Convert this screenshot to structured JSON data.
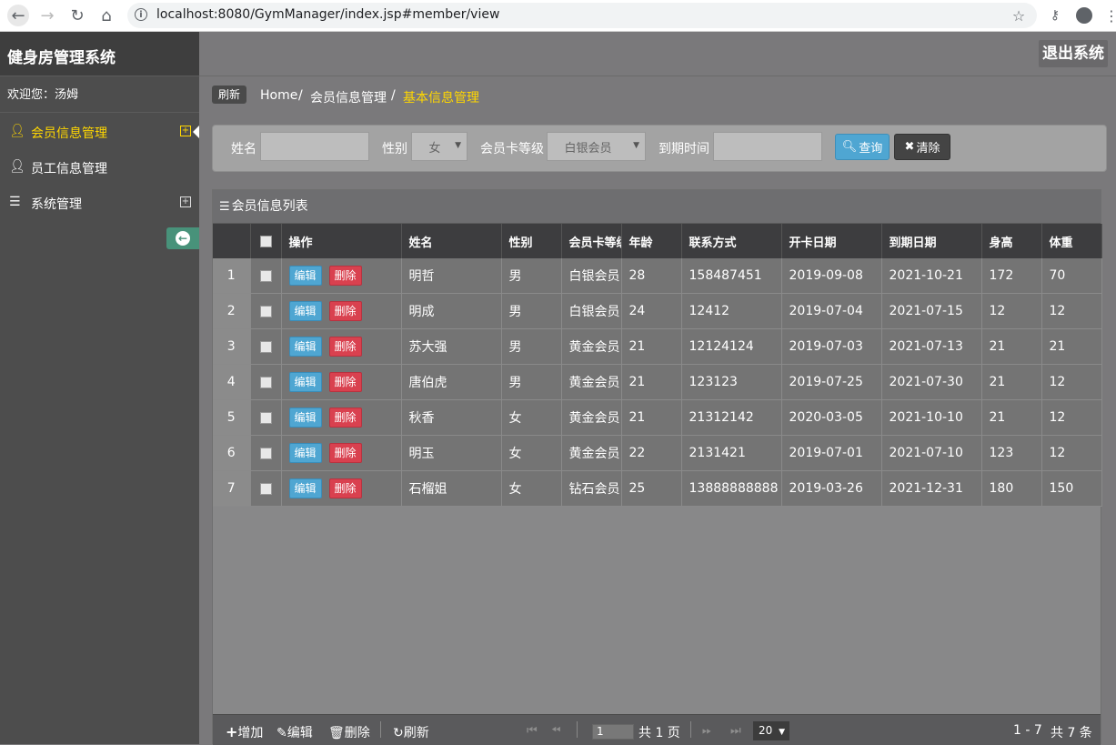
{
  "browser": {
    "url": "localhost:8080/GymManager/index.jsp#member/view"
  },
  "app": {
    "title": "健身房管理系统",
    "welcome": "欢迎您：汤姆",
    "logout": "退出系统"
  },
  "sidebar": {
    "items": [
      {
        "label": "会员信息管理",
        "icon": "user-icon",
        "active": true,
        "expandable": true
      },
      {
        "label": "员工信息管理",
        "icon": "user-icon",
        "active": false,
        "expandable": false
      },
      {
        "label": "系统管理",
        "icon": "list-icon",
        "active": false,
        "expandable": true
      }
    ]
  },
  "breadcrumb": {
    "refresh": "刷新",
    "home": "Home",
    "parent": "会员信息管理",
    "current": "基本信息管理",
    "sep": "/"
  },
  "search": {
    "name_label": "姓名",
    "name_value": "",
    "gender_label": "性别",
    "gender_value": "女",
    "level_label": "会员卡等级",
    "level_value": "白银会员",
    "expire_label": "到期时间",
    "expire_value": "",
    "query_btn": "查询",
    "clear_btn": "清除"
  },
  "grid": {
    "title": "会员信息列表",
    "columns": [
      "操作",
      "姓名",
      "性别",
      "会员卡等级",
      "年龄",
      "联系方式",
      "开卡日期",
      "到期日期",
      "身高",
      "体重"
    ],
    "edit_label": "编辑",
    "delete_label": "删除",
    "rows": [
      {
        "num": "1",
        "name": "明哲",
        "gender": "男",
        "level": "白银会员",
        "age": "28",
        "phone": "158487451",
        "start": "2019-09-08",
        "end": "2021-10-21",
        "height": "172",
        "weight": "70"
      },
      {
        "num": "2",
        "name": "明成",
        "gender": "男",
        "level": "白银会员",
        "age": "24",
        "phone": "12412",
        "start": "2019-07-04",
        "end": "2021-07-15",
        "height": "12",
        "weight": "12"
      },
      {
        "num": "3",
        "name": "苏大强",
        "gender": "男",
        "level": "黄金会员",
        "age": "21",
        "phone": "12124124",
        "start": "2019-07-03",
        "end": "2021-07-13",
        "height": "21",
        "weight": "21"
      },
      {
        "num": "4",
        "name": "唐伯虎",
        "gender": "男",
        "level": "黄金会员",
        "age": "21",
        "phone": "123123",
        "start": "2019-07-25",
        "end": "2021-07-30",
        "height": "21",
        "weight": "12"
      },
      {
        "num": "5",
        "name": "秋香",
        "gender": "女",
        "level": "黄金会员",
        "age": "21",
        "phone": "21312142",
        "start": "2020-03-05",
        "end": "2021-10-10",
        "height": "21",
        "weight": "12"
      },
      {
        "num": "6",
        "name": "明玉",
        "gender": "女",
        "level": "黄金会员",
        "age": "22",
        "phone": "2131421",
        "start": "2019-07-01",
        "end": "2021-07-10",
        "height": "123",
        "weight": "12"
      },
      {
        "num": "7",
        "name": "石榴姐",
        "gender": "女",
        "level": "钻石会员",
        "age": "25",
        "phone": "13888888888",
        "start": "2019-03-26",
        "end": "2021-12-31",
        "height": "180",
        "weight": "150"
      }
    ]
  },
  "footer": {
    "add": "增加",
    "edit": "编辑",
    "delete": "删除",
    "refresh": "刷新",
    "page": "1",
    "total_pages": "共 1 页",
    "page_size": "20",
    "range": "1 - 7",
    "total": "共 7 条"
  },
  "colors": {
    "accent": "#ffd700",
    "query": "#4fa6d2",
    "delete": "#d9414f",
    "collapse": "#48927a"
  }
}
